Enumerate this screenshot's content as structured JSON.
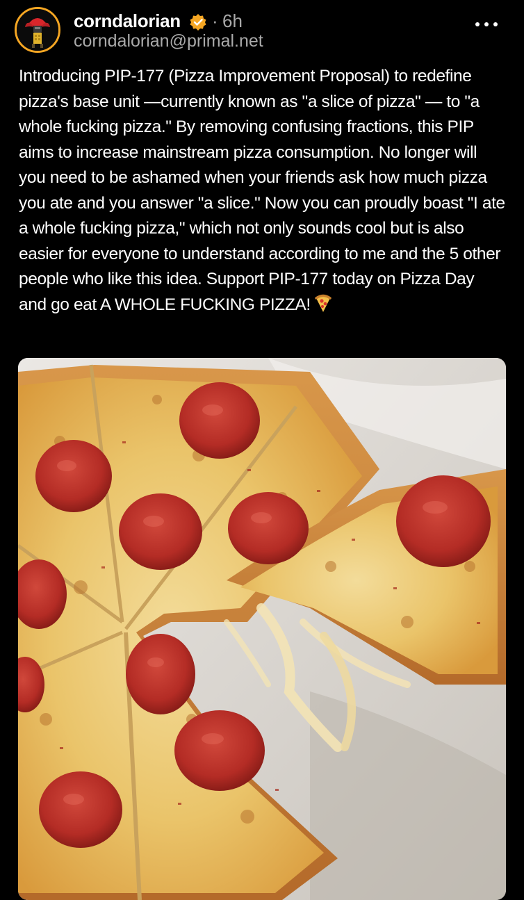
{
  "post": {
    "author": {
      "display_name": "corndalorian",
      "handle": "corndalorian@primal.net",
      "verified": true,
      "avatar_icon": "corn-mascot-icon"
    },
    "separator": "·",
    "timestamp": "6h",
    "menu_icon": "more-horizontal-icon",
    "body_text": "Introducing PIP-177 (Pizza Improvement Proposal) to redefine pizza's base unit —currently known as \"a slice of pizza\" — to \"a whole fucking pizza.\" By removing confusing fractions, this PIP aims to increase mainstream pizza consumption. No longer will you need to be ashamed when your friends ask how much pizza you ate and you answer \"a slice.\" Now you can proudly boast \"I ate a whole fucking pizza,\" which not only sounds cool but is also easier for everyone to understand according to me and the 5 other people who like this idea. Support PIP-177 today on Pizza Day and go eat A WHOLE FUCKING PIZZA!",
    "trailing_emoji_icon": "pizza-slice-emoji-icon",
    "image_icon": "pepperoni-pizza-photo"
  },
  "colors": {
    "background": "#000000",
    "text_primary": "#ffffff",
    "text_secondary": "#a9a9a9",
    "verified_badge": "#f5a623",
    "avatar_ring": "#f5a623"
  }
}
